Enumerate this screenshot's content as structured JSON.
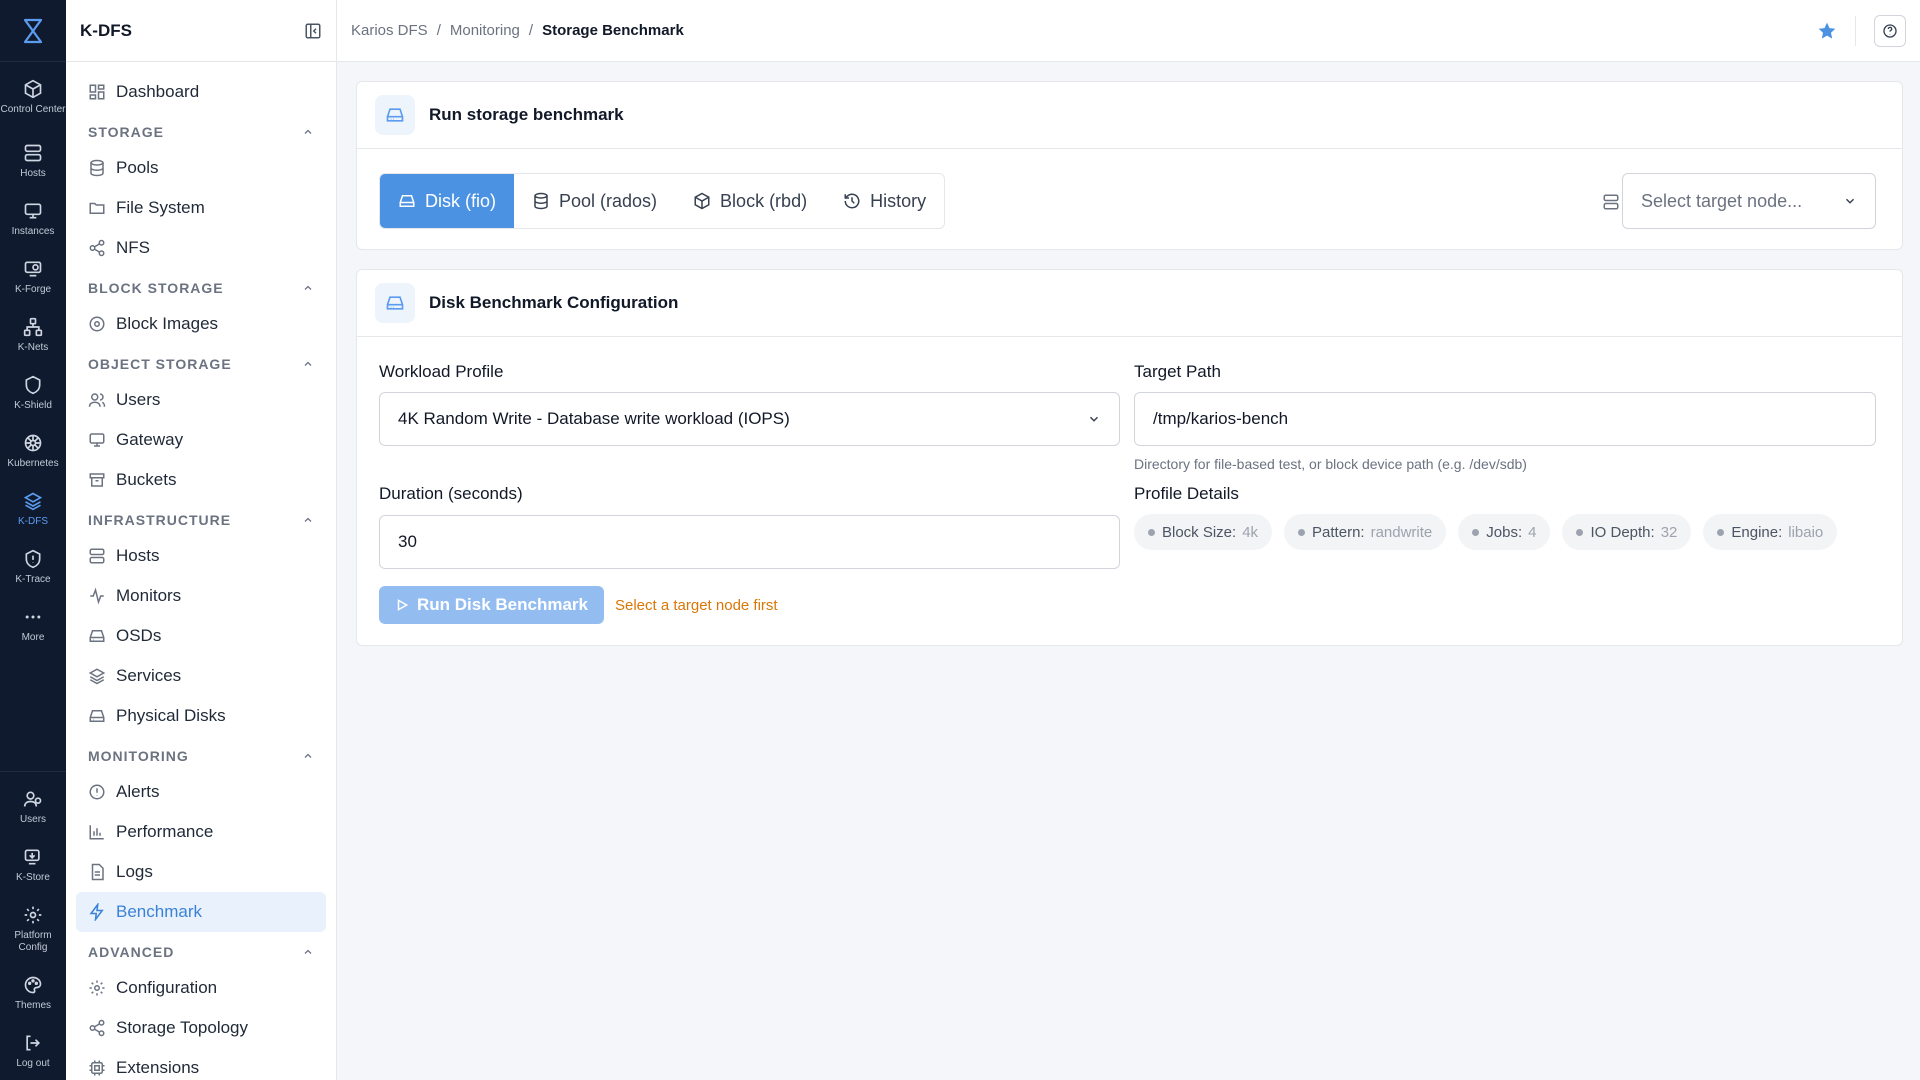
{
  "rail": {
    "items": [
      {
        "label": "Control Center",
        "icon": "cube-icon"
      },
      {
        "label": "Hosts",
        "icon": "server-icon"
      },
      {
        "label": "Instances",
        "icon": "monitor-icon"
      },
      {
        "label": "K-Forge",
        "icon": "forge-icon"
      },
      {
        "label": "K-Nets",
        "icon": "network-icon"
      },
      {
        "label": "K-Shield",
        "icon": "shield-icon"
      },
      {
        "label": "Kubernetes",
        "icon": "helm-icon"
      },
      {
        "label": "K-DFS",
        "icon": "layers-icon",
        "active": true
      },
      {
        "label": "K-Trace",
        "icon": "shield-alert-icon"
      },
      {
        "label": "More",
        "icon": "more-icon"
      }
    ],
    "bottom": [
      {
        "label": "Users",
        "icon": "users-icon"
      },
      {
        "label": "K-Store",
        "icon": "store-icon"
      },
      {
        "label": "Platform Config",
        "icon": "gear-icon"
      },
      {
        "label": "Themes",
        "icon": "palette-icon"
      },
      {
        "label": "Log out",
        "icon": "logout-icon"
      }
    ]
  },
  "sidebar": {
    "title": "K-DFS",
    "dashboard": "Dashboard",
    "sections": {
      "storage": {
        "label": "STORAGE",
        "items": [
          "Pools",
          "File System",
          "NFS"
        ]
      },
      "block": {
        "label": "BLOCK STORAGE",
        "items": [
          "Block Images"
        ]
      },
      "object": {
        "label": "OBJECT STORAGE",
        "items": [
          "Users",
          "Gateway",
          "Buckets"
        ]
      },
      "infra": {
        "label": "INFRASTRUCTURE",
        "items": [
          "Hosts",
          "Monitors",
          "OSDs",
          "Services",
          "Physical Disks"
        ]
      },
      "monitoring": {
        "label": "MONITORING",
        "items": [
          "Alerts",
          "Performance",
          "Logs",
          "Benchmark"
        ]
      },
      "advanced": {
        "label": "ADVANCED",
        "items": [
          "Configuration",
          "Storage Topology",
          "Extensions"
        ]
      }
    }
  },
  "topbar": {
    "breadcrumb": [
      "Karios DFS",
      "Monitoring",
      "Storage Benchmark"
    ]
  },
  "run_card": {
    "title": "Run storage benchmark",
    "tabs": [
      "Disk (fio)",
      "Pool (rados)",
      "Block (rbd)",
      "History"
    ],
    "active_tab": 0,
    "node_placeholder": "Select target node..."
  },
  "config_card": {
    "title": "Disk Benchmark Configuration",
    "workload_label": "Workload Profile",
    "workload_value": "4K Random Write - Database write workload (IOPS)",
    "target_label": "Target Path",
    "target_value": "/tmp/karios-bench",
    "target_hint": "Directory for file-based test, or block device path (e.g. /dev/sdb)",
    "duration_label": "Duration (seconds)",
    "duration_value": "30",
    "profile_label": "Profile Details",
    "profile": [
      {
        "key": "Block Size:",
        "value": "4k"
      },
      {
        "key": "Pattern:",
        "value": "randwrite"
      },
      {
        "key": "Jobs:",
        "value": "4"
      },
      {
        "key": "IO Depth:",
        "value": "32"
      },
      {
        "key": "Engine:",
        "value": "libaio"
      }
    ],
    "run_button": "Run Disk Benchmark",
    "warning": "Select a target node first"
  },
  "colors": {
    "accent": "#4b92e3",
    "rail_bg": "#0f1a2e",
    "warning": "#d97706"
  }
}
